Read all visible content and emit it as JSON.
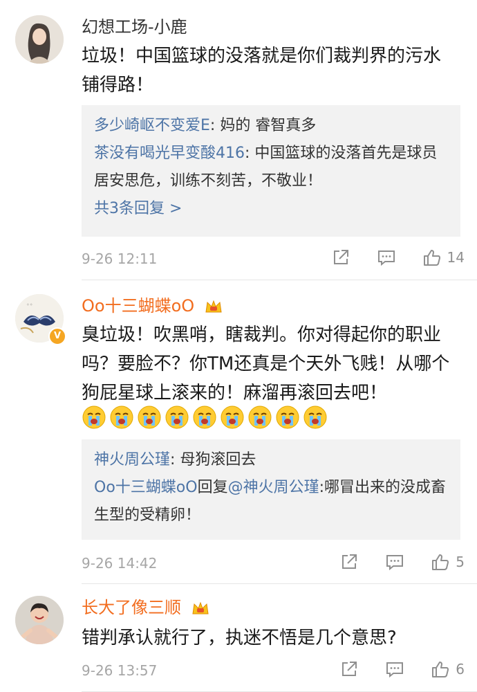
{
  "comments": [
    {
      "username": "幻想工场-小鹿",
      "vip": false,
      "verified": false,
      "text": "垃圾！中国篮球的没落就是你们裁判界的污水铺得路！",
      "replies": [
        {
          "name": "多少崎岖不变爱E",
          "sep": ": ",
          "content": "妈的 睿智真多"
        },
        {
          "name": "茶没有喝光早变酸416",
          "sep": ": ",
          "content": "中国篮球的没落首先是球员居安思危，训练不刻苦，不敬业！"
        }
      ],
      "more_replies": "共3条回复 >",
      "time": "9-26 12:11",
      "likes": "14"
    },
    {
      "username": "Oo十三蝴蝶oO",
      "vip": true,
      "verified": true,
      "text": "臭垃圾！吹黑哨，瞎裁判。你对得起你的职业吗？要脸不？你TM还真是个天外飞贱！从哪个狗屁星球上滚来的！麻溜再滚回去吧！",
      "emoji_count": 9,
      "emoji_name": "crying-emoji",
      "replies": [
        {
          "name": "神火周公瑾",
          "sep": ": ",
          "content": "母狗滚回去"
        },
        {
          "name": "Oo十三蝴蝶oO",
          "mid": "回复",
          "name2": "@神火周公瑾",
          "sep": ":",
          "content": "哪冒出来的没成畜生型的受精卵！"
        }
      ],
      "time": "9-26 14:42",
      "likes": "5"
    },
    {
      "username": "长大了像三顺",
      "vip": true,
      "verified": false,
      "text": "错判承认就行了，执迷不悟是几个意思?",
      "time": "9-26 13:57",
      "likes": "6"
    }
  ],
  "icons": {
    "share": "share-icon",
    "comment": "comment-icon",
    "like": "thumbs-up-icon",
    "crown": "vip-crown-icon",
    "verified": "verified-v-icon"
  },
  "colors": {
    "link": "#4d74a6",
    "vip_name": "#f26d1f",
    "meta": "#a6a6a6",
    "reply_bg": "#f2f2f2"
  }
}
